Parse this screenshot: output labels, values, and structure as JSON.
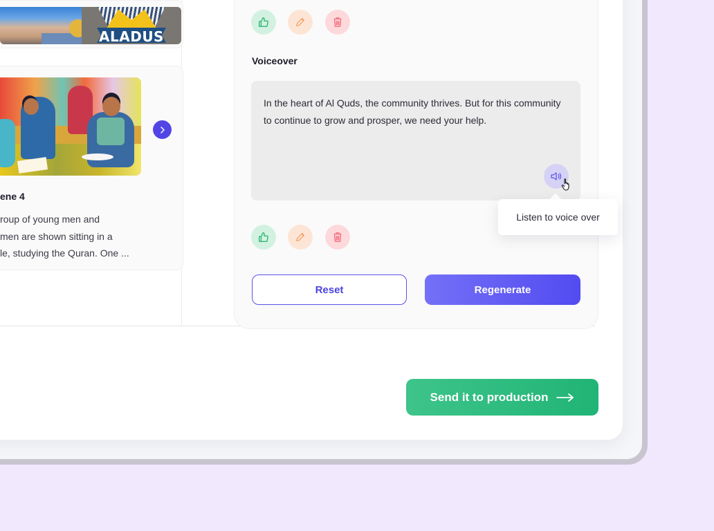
{
  "colors": {
    "backdrop": "#f1e8fd",
    "accent": "#5146e5",
    "success": "#20b475",
    "like_bg": "#d3f1e1",
    "edit_bg": "#fde5d6",
    "delete_bg": "#fdd9dc"
  },
  "left_panel": {
    "thumbnail_card": {
      "images": [
        {
          "alt": "Jerusalem skyline with golden dome"
        },
        {
          "alt": "Aladus logo",
          "logo_text": "ALADUS"
        }
      ]
    },
    "scene_card": {
      "image_alt": "Illustration of young men and women sitting in a circle studying",
      "title": "ene 4",
      "description": "roup of young men and\nmen are shown sitting in a\nle, studying the Quran. One ...",
      "next_icon": "chevron-right-icon"
    }
  },
  "script_card": {
    "top_actions": [
      {
        "name": "like",
        "icon": "thumbs-up-icon"
      },
      {
        "name": "edit",
        "icon": "pencil-icon"
      },
      {
        "name": "delete",
        "icon": "trash-icon"
      }
    ],
    "voiceover": {
      "label": "Voiceover",
      "text": "In the heart of Al Quds, the community thrives. But for this community to continue to grow and prosper, we need your help.",
      "speaker_icon": "speaker-icon",
      "tooltip": "Listen to voice over"
    },
    "bottom_actions": [
      {
        "name": "like",
        "icon": "thumbs-up-icon"
      },
      {
        "name": "edit",
        "icon": "pencil-icon"
      },
      {
        "name": "delete",
        "icon": "trash-icon"
      }
    ],
    "reset_label": "Reset",
    "regenerate_label": "Regenerate"
  },
  "footer": {
    "send_label": "Send it to production",
    "send_icon": "arrow-right-icon"
  }
}
